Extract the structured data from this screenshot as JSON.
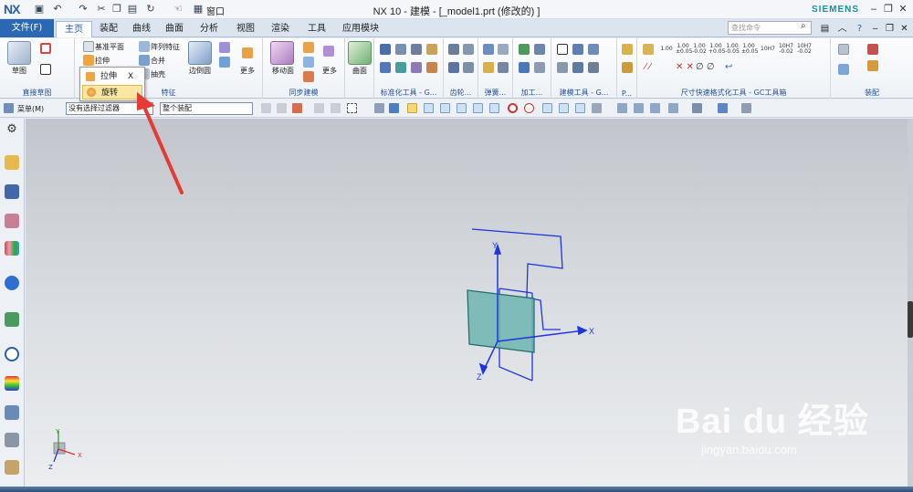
{
  "title_bar": {
    "logo": "NX",
    "window_menu_label": "窗口",
    "title": "NX 10 - 建模 - [_model1.prt  (修改的) ]",
    "brand": "SIEMENS"
  },
  "tabs": {
    "file": "文件(F)",
    "items": [
      "主页",
      "装配",
      "曲线",
      "曲面",
      "分析",
      "视图",
      "渲染",
      "工具",
      "应用模块"
    ],
    "active": "主页"
  },
  "search": {
    "placeholder": "查找命令"
  },
  "ribbon": {
    "sketch_label": "草图",
    "direct_sketch_label": "直接草图",
    "datum_plane": "基准平面",
    "array_feature": "阵列特征",
    "extrude": "拉伸",
    "unite": "合并",
    "shell": "抽壳",
    "edge_blend": "边倒圆",
    "more": "更多",
    "feature_label": "特征",
    "move_face": "移动面",
    "sync_label": "同步建模",
    "surface": "曲面",
    "std_tools_label": "标准化工具 - G...",
    "gear_label": "齿轮...",
    "spring_label": "弹簧...",
    "machining_label": "加工...",
    "modeling_tools_label": "建模工具 - G...",
    "p_label": "P...",
    "dim_label": "尺寸快速格式化工具 - GC工具箱",
    "assembly_label": "装配",
    "dim_texts": [
      "1.00",
      "1.00\n±0.05",
      "1.00\n-0.02",
      "1.00\n+0.05",
      "1.00\n-0.05",
      "1.00\n±0.05",
      "10H7",
      "10H7\n-0.02",
      "10H7\n-0.02"
    ]
  },
  "dropdown": {
    "items": [
      "拉伸",
      "旋转"
    ],
    "hotkey": "X",
    "highlighted": "旋转"
  },
  "toolbar": {
    "menu_label": "菜单(M)",
    "filter_value": "没有选择过滤器",
    "scope_value": "整个装配"
  },
  "axes": {
    "x": "X",
    "y": "Y",
    "z": "Z"
  },
  "watermark": {
    "line1": "Bai du 经验",
    "line2": "jingyan.baidu.com"
  },
  "colors": {
    "accent": "#2b67b3",
    "sketch_line": "#1f35e0",
    "solid_face": "#6fb5b0",
    "arrow": "#e53a35"
  }
}
